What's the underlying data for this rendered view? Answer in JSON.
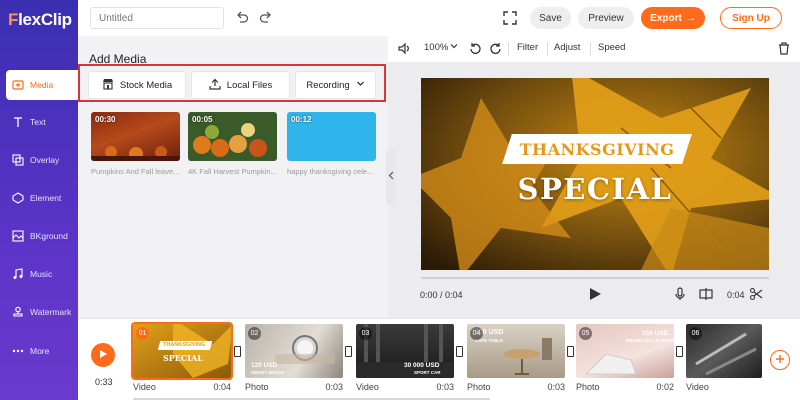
{
  "app": {
    "name_f": "F",
    "name_rest": "lexClip",
    "project_placeholder": "Untitled"
  },
  "sidebar": {
    "items": [
      {
        "label": "Media",
        "icon": "media-icon",
        "active": true
      },
      {
        "label": "Text",
        "icon": "text-icon"
      },
      {
        "label": "Overlay",
        "icon": "overlay-icon"
      },
      {
        "label": "Element",
        "icon": "element-icon"
      },
      {
        "label": "BKground",
        "icon": "background-icon"
      },
      {
        "label": "Music",
        "icon": "music-icon"
      },
      {
        "label": "Watermark",
        "icon": "watermark-icon"
      },
      {
        "label": "More",
        "icon": "more-icon"
      }
    ]
  },
  "topbar": {
    "save": "Save",
    "preview": "Preview",
    "export": "Export",
    "export_arrow": "→",
    "signup": "Sign Up"
  },
  "media": {
    "title": "Add Media",
    "tabs": {
      "stock": "Stock Media",
      "local": "Local Files",
      "recording": "Recording"
    },
    "thumbs": [
      {
        "duration": "00:30",
        "caption": "Pumpkins And Fall leave..."
      },
      {
        "duration": "00:05",
        "caption": "4K Fall Harvest Pumpkin..."
      },
      {
        "duration": "00:12",
        "caption": "happy thanksgiving cele..."
      }
    ]
  },
  "preview": {
    "zoom": "100%",
    "filter": "Filter",
    "adjust": "Adjust",
    "speed": "Speed",
    "canvas_title": "THANKSGIVING",
    "canvas_subtitle": "SPECIAL",
    "time_current": "0:00 / 0:04",
    "time_right": "0:04"
  },
  "timeline": {
    "total_time": "0:33",
    "clips": [
      {
        "num": "01",
        "type": "Video",
        "duration": "0:04",
        "text1": "THANKSGIVING",
        "text2": "SPECIAL"
      },
      {
        "num": "02",
        "type": "Photo",
        "duration": "0:03",
        "text1": "120 USD",
        "text2": "SMART WATCH"
      },
      {
        "num": "03",
        "type": "Video",
        "duration": "0:03",
        "text1": "30 000 USD",
        "text2": "SPORT CAR"
      },
      {
        "num": "04",
        "type": "Photo",
        "duration": "0:03",
        "text1": "300 USD",
        "text2": "CAFE TABLE"
      },
      {
        "num": "05",
        "type": "Photo",
        "duration": "0:02",
        "text1": "150 USD",
        "text2": "BRAND COLLECTION"
      },
      {
        "num": "06",
        "type": "Video",
        "duration": "",
        "text1": "",
        "text2": ""
      }
    ]
  },
  "colors": {
    "accent": "#ff6b1a",
    "sidebar": "#4a32bd",
    "highlight": "#d9343b"
  }
}
